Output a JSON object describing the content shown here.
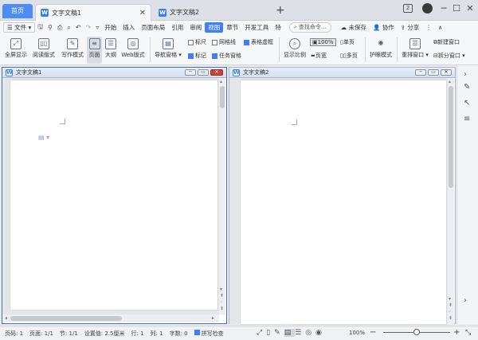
{
  "tabs": {
    "home": "首页",
    "doc1": "文字文稿1",
    "doc2": "文字文稿2",
    "doc_icon": "W"
  },
  "window": {
    "badge": "2",
    "minimize": "─",
    "maximize": "☐",
    "close": "✕"
  },
  "menubar": {
    "file": "☰ 文件 ▾",
    "items": [
      "开始",
      "插入",
      "页面布局",
      "引用",
      "审阅",
      "视图",
      "章节",
      "开发工具",
      "特"
    ],
    "active_index": 5,
    "search": "查找命令...",
    "unsaved": "未保存",
    "collab": "协作",
    "share": "分享"
  },
  "ribbon": {
    "fullscreen": "全屏显示",
    "reading": "阅读版式",
    "writing": "写作模式",
    "page": "页面",
    "outline": "大纲",
    "web": "Web版式",
    "nav_pane": "导航窗格 ▾",
    "ruler": "标尺",
    "gridlines": "网格线",
    "table_grid": "表格虚框",
    "marks": "标记",
    "task_pane": "任务窗格",
    "zoom": "显示比例",
    "zoom_pct": "100%",
    "single_page": "单页",
    "page_width": "页宽",
    "multi_page": "多页",
    "eye_mode": "护眼模式",
    "rearrange": "重排窗口 ▾",
    "new_window": "新建窗口",
    "split_window": "拆分窗口 ▾"
  },
  "docs": {
    "left_title": "文字文稿1",
    "right_title": "文字文稿2"
  },
  "status": {
    "page_no": "页码: 1",
    "pages": "页面: 1/1",
    "section": "节: 1/1",
    "setting": "设置值: 2.5厘米",
    "row": "行: 1",
    "col": "列: 1",
    "words": "字数: 0",
    "spell": "拼写检查",
    "zoom": "100%",
    "minus": "−",
    "plus": "+"
  },
  "zoom_slider_fraction": 0.5,
  "colors": {
    "accent": "#3f7ff5",
    "home_tab": "#4b8cf5",
    "close_btn": "#c9423a"
  }
}
